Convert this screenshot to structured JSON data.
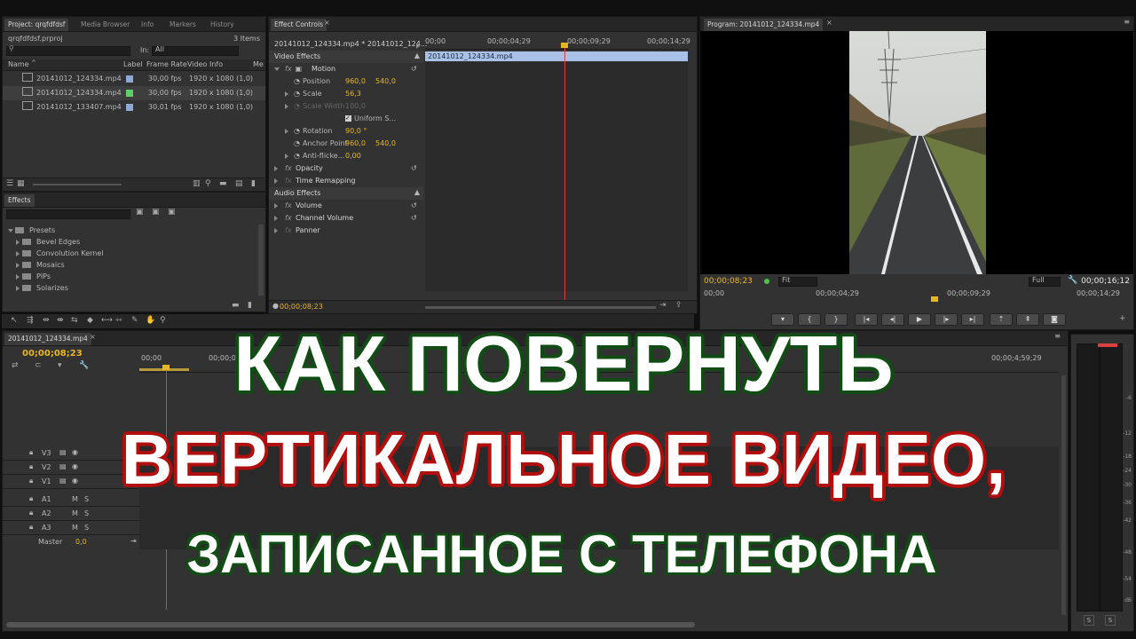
{
  "project": {
    "tabs": [
      "Project: qrqfdfdsf",
      "Media Browser",
      "Info",
      "Markers",
      "History"
    ],
    "file": "qrqfdfdsf.prproj",
    "count": "3 Items",
    "in_label": "In:",
    "in_value": "All",
    "columns": [
      "Name",
      "Label",
      "Frame Rate",
      "Video Info",
      "Me"
    ],
    "rows": [
      {
        "name": "20141012_124334.mp4",
        "label_color": "#8fa9d6",
        "rate": "30,00 fps",
        "info": "1920 x 1080 (1,0)"
      },
      {
        "name": "20141012_124334.mp4",
        "label_color": "#5fcf6a",
        "rate": "30,00 fps",
        "info": "1920 x 1080 (1,0)"
      },
      {
        "name": "20141012_133407.mp4",
        "label_color": "#8fa9d6",
        "rate": "30,01 fps",
        "info": "1920 x 1080 (1,0)"
      }
    ]
  },
  "effects": {
    "tab": "Effects",
    "tree": [
      "Presets",
      "Bevel Edges",
      "Convolution Kernel",
      "Mosaics",
      "PIPs",
      "Solarizes"
    ]
  },
  "effect_controls": {
    "tab": "Effect Controls",
    "clip_header": "20141012_124334.mp4 * 20141012_124...",
    "ruler": [
      "00;00",
      "00;00;04;29",
      "00;00;09;29",
      "00;00;14;29"
    ],
    "clip_bar": "20141012_124334.mp4",
    "video_effects": "Video Effects",
    "motion": "Motion",
    "position_label": "Position",
    "position_x": "960,0",
    "position_y": "540,0",
    "scale_label": "Scale",
    "scale_value": "56,3",
    "scale_width_label": "Scale Width",
    "scale_width_value": "100,0",
    "uniform_label": "Uniform S...",
    "rotation_label": "Rotation",
    "rotation_value": "90,0 °",
    "anchor_label": "Anchor Point",
    "anchor_x": "960,0",
    "anchor_y": "540,0",
    "antiflicker_label": "Anti-flicke...",
    "antiflicker_value": "0,00",
    "opacity": "Opacity",
    "time_remap": "Time Remapping",
    "audio_effects": "Audio Effects",
    "volume": "Volume",
    "channel_volume": "Channel Volume",
    "panner": "Panner",
    "timecode": "00;00;08;23"
  },
  "program": {
    "tab": "Program: 20141012_124334.mp4",
    "timecode": "00;00;08;23",
    "fit": "Fit",
    "quality": "Full",
    "duration": "00;00;16;12",
    "ruler": [
      "00;00",
      "00;00;04;29",
      "00;00;09;29",
      "00;00;14;29"
    ]
  },
  "timeline": {
    "tab": "20141012_124334.mp4",
    "timecode": "00;00;08;23",
    "ruler": [
      "00;00",
      "00;00;04;29",
      "00;00;4;59;29"
    ],
    "video_tracks": [
      "V3",
      "V2",
      "V1"
    ],
    "audio_tracks": [
      "A1",
      "A2",
      "A3"
    ],
    "master_label": "Master",
    "master_value": "0,0"
  },
  "meter": {
    "ticks": [
      "-6",
      "-12",
      "-18",
      "-24",
      "-30",
      "-36",
      "-42",
      "-48",
      "-54",
      "dB"
    ],
    "solo": [
      "S",
      "S"
    ]
  },
  "overlay": {
    "line1": "КАК ПОВЕРНУТЬ",
    "line2": "ВЕРТИКАЛЬНОЕ ВИДЕО,",
    "line3": "ЗАПИСАННОЕ С ТЕЛЕФОНА"
  }
}
